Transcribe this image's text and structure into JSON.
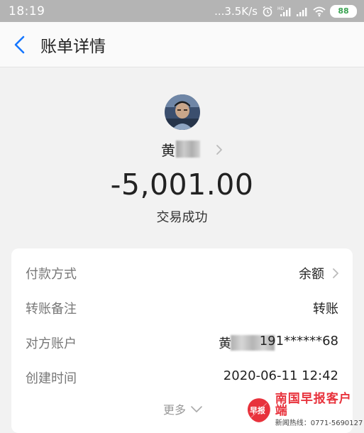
{
  "status_bar": {
    "time": "18:19",
    "network_speed": "...3.5K/s",
    "battery": "88",
    "icons": [
      "alarm-icon",
      "signal-hd-icon",
      "signal-icon",
      "wifi-icon",
      "battery-icon"
    ]
  },
  "nav": {
    "title": "账单详情",
    "back_icon": "chevron-left-icon"
  },
  "payee": {
    "name_visible": "黄",
    "name_masked": true,
    "amount": "-5,001.00",
    "status": "交易成功"
  },
  "details": [
    {
      "label": "付款方式",
      "value": "余额",
      "has_chevron": true
    },
    {
      "label": "转账备注",
      "value": "转账"
    },
    {
      "label": "对方账户",
      "value_prefix": "黄",
      "value_suffix": "191******68",
      "masked": true
    },
    {
      "label": "创建时间",
      "value": "2020-06-11 12:42"
    }
  ],
  "more": {
    "label": "更多"
  },
  "watermark": {
    "logo_text": "早报",
    "name": "南国早报客户端",
    "hotline": "新闻热线：0771-5690127"
  },
  "colors": {
    "accent_blue": "#1677ff",
    "watermark_red": "#e8323c",
    "status_bar_bg": "#b4b4b4",
    "battery_green": "#3aa352"
  }
}
